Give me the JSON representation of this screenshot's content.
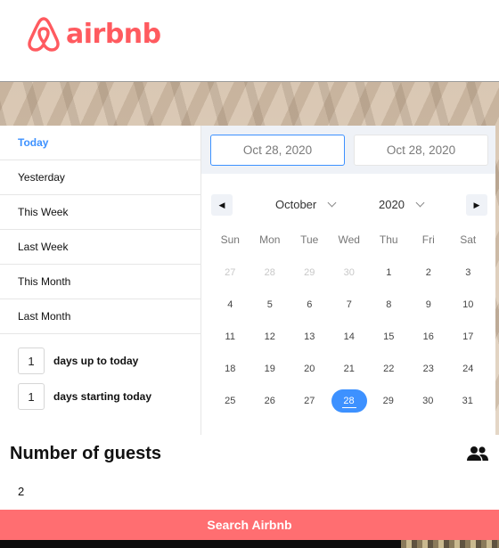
{
  "brand": {
    "name": "airbnb",
    "color": "#ff5a5f"
  },
  "ranges": [
    {
      "label": "Today",
      "active": true
    },
    {
      "label": "Yesterday",
      "active": false
    },
    {
      "label": "This Week",
      "active": false
    },
    {
      "label": "Last Week",
      "active": false
    },
    {
      "label": "This Month",
      "active": false
    },
    {
      "label": "Last Month",
      "active": false
    }
  ],
  "days_up": {
    "value": "1",
    "label": "days up to today"
  },
  "days_start": {
    "value": "1",
    "label": "days starting today"
  },
  "calendar": {
    "start_date": "Oct 28, 2020",
    "end_date": "Oct 28, 2020",
    "month": "October",
    "year": "2020",
    "weekdays": [
      "Sun",
      "Mon",
      "Tue",
      "Wed",
      "Thu",
      "Fri",
      "Sat"
    ],
    "weeks": [
      [
        {
          "d": "27",
          "m": true
        },
        {
          "d": "28",
          "m": true
        },
        {
          "d": "29",
          "m": true
        },
        {
          "d": "30",
          "m": true
        },
        {
          "d": "1"
        },
        {
          "d": "2"
        },
        {
          "d": "3"
        }
      ],
      [
        {
          "d": "4"
        },
        {
          "d": "5"
        },
        {
          "d": "6"
        },
        {
          "d": "7"
        },
        {
          "d": "8"
        },
        {
          "d": "9"
        },
        {
          "d": "10"
        }
      ],
      [
        {
          "d": "11"
        },
        {
          "d": "12"
        },
        {
          "d": "13"
        },
        {
          "d": "14"
        },
        {
          "d": "15"
        },
        {
          "d": "16"
        },
        {
          "d": "17"
        }
      ],
      [
        {
          "d": "18"
        },
        {
          "d": "19"
        },
        {
          "d": "20"
        },
        {
          "d": "21"
        },
        {
          "d": "22"
        },
        {
          "d": "23"
        },
        {
          "d": "24"
        }
      ],
      [
        {
          "d": "25"
        },
        {
          "d": "26"
        },
        {
          "d": "27"
        },
        {
          "d": "28",
          "s": true
        },
        {
          "d": "29"
        },
        {
          "d": "30"
        },
        {
          "d": "31"
        }
      ]
    ],
    "accent": "#3d91ff"
  },
  "guests": {
    "title": "Number of guests",
    "value": "2",
    "icon": "people-icon"
  },
  "search": {
    "label": "Search Airbnb",
    "color": "#ff6e71"
  }
}
